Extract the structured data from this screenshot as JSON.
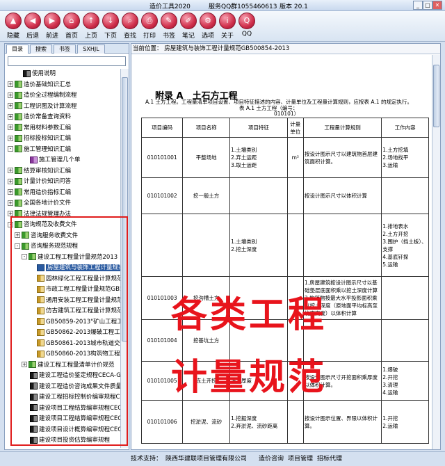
{
  "window": {
    "title": "造价工具2020",
    "service": "服务QQ群1055460613",
    "version": "版本 20.1"
  },
  "toolbar": {
    "buttons": [
      "隐藏",
      "后退",
      "前进",
      "首页",
      "上页",
      "下页",
      "查找",
      "打印",
      "书签",
      "笔记",
      "选项",
      "关于",
      "QQ"
    ]
  },
  "left": {
    "tabs": [
      "目录",
      "搜索",
      "书签",
      "SXHJL"
    ],
    "search_value": "",
    "tree": [
      {
        "label": "使用说明",
        "indent": 1,
        "exp": "",
        "icon": "b"
      },
      {
        "label": "造价基础知识汇总",
        "indent": 0,
        "exp": "+",
        "icon": "g"
      },
      {
        "label": "造价全过程编制流程",
        "indent": 0,
        "exp": "+",
        "icon": "g"
      },
      {
        "label": "工程识图及计算流程",
        "indent": 0,
        "exp": "+",
        "icon": "g"
      },
      {
        "label": "造价常备查询资料",
        "indent": 0,
        "exp": "+",
        "icon": "g"
      },
      {
        "label": "常用材料参数汇编",
        "indent": 0,
        "exp": "+",
        "icon": "g"
      },
      {
        "label": "招标投标知识汇编",
        "indent": 0,
        "exp": "+",
        "icon": "g"
      },
      {
        "label": "施工管理知识汇编",
        "indent": 0,
        "exp": "-",
        "icon": "g"
      },
      {
        "label": "施工管理几个单",
        "indent": 2,
        "exp": "",
        "icon": "p"
      },
      {
        "label": "结算审核知识汇编",
        "indent": 0,
        "exp": "+",
        "icon": "g"
      },
      {
        "label": "计量计价知识问答",
        "indent": 0,
        "exp": "+",
        "icon": "g"
      },
      {
        "label": "常用造价指标汇编",
        "indent": 0,
        "exp": "+",
        "icon": "g"
      },
      {
        "label": "全国各地计价文件",
        "indent": 0,
        "exp": "+",
        "icon": "g"
      },
      {
        "label": "法律法规管理办法",
        "indent": 0,
        "exp": "+",
        "icon": "g"
      },
      {
        "label": "咨询规范及收费文件",
        "indent": 0,
        "exp": "-",
        "icon": "g"
      },
      {
        "label": "咨询服务收费文件",
        "indent": 1,
        "exp": "+",
        "icon": "g"
      },
      {
        "label": "咨询服务规范规程",
        "indent": 1,
        "exp": "-",
        "icon": "g"
      },
      {
        "label": "建设工程工程量计量规范2013",
        "indent": 2,
        "exp": "-",
        "icon": "g"
      },
      {
        "label": "房屋建筑与装饰工程计量规范",
        "indent": 3,
        "exp": "",
        "icon": "u",
        "selected": true
      },
      {
        "label": "园林绿化工程工程量计算规范",
        "indent": 3,
        "exp": "",
        "icon": "y"
      },
      {
        "label": "市政工程工程量计量规范GB50857-20",
        "indent": 3,
        "exp": "",
        "icon": "y"
      },
      {
        "label": "通用安装工程工程量计量规范GB5005",
        "indent": 3,
        "exp": "",
        "icon": "y"
      },
      {
        "label": "仿古建筑工程工程量计算规范GB5085",
        "indent": 3,
        "exp": "",
        "icon": "y"
      },
      {
        "label": "GB50859-2013\"矿山工程工程量",
        "indent": 3,
        "exp": "",
        "icon": "y"
      },
      {
        "label": "GB50862-2013爆破工程工程量",
        "indent": 3,
        "exp": "",
        "icon": "y"
      },
      {
        "label": "GB50861-2013城市轨道交通工",
        "indent": 3,
        "exp": "",
        "icon": "y"
      },
      {
        "label": "GB50860-2013构筑物工程工程",
        "indent": 3,
        "exp": "",
        "icon": "y"
      },
      {
        "label": "建设工程工程量清单计价规范",
        "indent": 2,
        "exp": "+",
        "icon": "g"
      },
      {
        "label": "建设工程造价鉴定规程CECA-GC",
        "indent": 2,
        "exp": "",
        "icon": "b"
      },
      {
        "label": "建设工程造价咨询成果文件质量标",
        "indent": 2,
        "exp": "",
        "icon": "b"
      },
      {
        "label": "建设工程招标控制价编审规程CEC",
        "indent": 2,
        "exp": "",
        "icon": "b"
      },
      {
        "label": "建设项目工程结算编审规程CECA/",
        "indent": 2,
        "exp": "",
        "icon": "b"
      },
      {
        "label": "建设项目工程结算编审规程CECA",
        "indent": 2,
        "exp": "",
        "icon": "b"
      },
      {
        "label": "建设项目设计概算编审规程CECA-",
        "indent": 2,
        "exp": "",
        "icon": "b"
      },
      {
        "label": "建设项目投资估算编审规程",
        "indent": 2,
        "exp": "",
        "icon": "b"
      }
    ]
  },
  "right": {
    "location": "当前位置： 房屋建筑与装饰工程计量规范GB500854-2013",
    "heading": "附录 A　土石方工程",
    "note": "A.1 土方工程。工程量清单项目设置、项目特征描述的内容、计量单位及工程量计算规则，应按表 A.1 的规定执行。",
    "caption": "表 A.1 土方工程（编号：",
    "caption_code": "010101）",
    "table": {
      "headers": [
        "项目编码",
        "项目名称",
        "项目特征",
        "计量单位",
        "工程量计算规则",
        "工作内容"
      ],
      "rows": [
        {
          "code": "010101001",
          "name": "平整场地",
          "feature": "1.土壤类别\n2.弃土运距\n3.取土运距",
          "unit": "m²",
          "rule": "按设计图示尺寸以建筑物首层建筑面积计算。",
          "work": "1.土方挖填\n2.场地找平\n3.运输"
        },
        {
          "code": "010101002",
          "name": "挖一般土方",
          "feature": "",
          "unit": "",
          "rule": "按设计图示尺寸以体积计算",
          "work": ""
        },
        {
          "code": "",
          "name": "",
          "feature": "1.土壤类别\n2.挖土深度",
          "unit": "",
          "rule": "",
          "work": "1.排地表水\n2.土方开挖\n3.围护（挡土板）、支撑\n4.基底钎探\n5.运输"
        },
        {
          "code": "010101003",
          "name": "挖沟槽土方",
          "feature": "",
          "unit": "",
          "rule": "1.房屋建筑按设计图示尺寸以基础垫层底面积乘以挖土深度计算\n2.构筑物按最大水平投影面积乘以挖土深度（原地面平均标高至坑底高度）以体积计算",
          "work": ""
        },
        {
          "code": "010101004",
          "name": "挖基坑土方",
          "feature": "",
          "unit": "",
          "rule": "",
          "work": ""
        },
        {
          "code": "010101005",
          "name": "冻土开挖",
          "feature": "冻土厚度",
          "unit": "",
          "rule": "按设计图示尺寸开挖面积乘厚度以体积计算。",
          "work": "1.爆破\n2.开挖\n3.清理\n4.运输"
        },
        {
          "code": "010101006",
          "name": "挖淤泥、流砂",
          "feature": "1.挖掘深度\n2.弃淤泥、流砂距离",
          "unit": "",
          "rule": "按设计图示位置、界限以体积计算。",
          "work": "1.开挖\n2.运输"
        }
      ]
    }
  },
  "overlay": {
    "line1": "各类工程",
    "line2": "计量规范"
  },
  "status": {
    "label": "技术支持：",
    "company": "陕西华建联项目管理有限公司",
    "links": [
      "造价咨询",
      "项目管理",
      "招标代理"
    ]
  }
}
